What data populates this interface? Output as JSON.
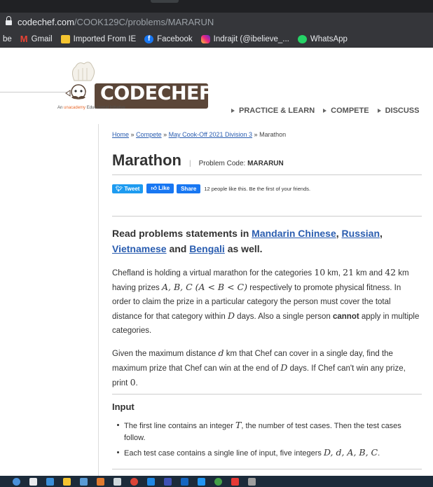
{
  "browser": {
    "url_host": "codechef.com",
    "url_path": "/COOK129C/problems/MARARUN",
    "bookmarks": [
      {
        "label": "Gmail",
        "icon": "gmail-icon"
      },
      {
        "label": "Imported From IE",
        "icon": "folder-icon"
      },
      {
        "label": "Facebook",
        "icon": "facebook-icon"
      },
      {
        "label": "Indrajit (@ibelieve_...",
        "icon": "instagram-icon"
      },
      {
        "label": "WhatsApp",
        "icon": "whatsapp-icon"
      }
    ],
    "bookmark_prefix": "be"
  },
  "header": {
    "logo_text": "CODECHEF",
    "tagline_pre": "An",
    "tagline_brand": "unacademy",
    "tagline_post": "Educational Initiative",
    "nav": [
      "PRACTICE & LEARN",
      "COMPETE",
      "DISCUSS"
    ]
  },
  "breadcrumb": {
    "home": "Home",
    "sep1": "»",
    "compete": "Compete",
    "sep2": "»",
    "contest": "May Cook-Off 2021 Division 3",
    "sep3": "»",
    "current": "Marathon"
  },
  "problem": {
    "title": "Marathon",
    "separator": "|",
    "code_label": "Problem Code:",
    "code": "MARARUN"
  },
  "social": {
    "tweet": "Tweet",
    "like": "Like",
    "share": "Share",
    "like_text": "12 people like this. Be the first of your friends."
  },
  "read_statements": {
    "pre": "Read problems statements in",
    "lang1": "Mandarin Chinese",
    "comma": ",",
    "lang2": "Russian",
    "comma2": ",",
    "lang3": "Vietnamese",
    "and": "and",
    "lang4": "Bengali",
    "post": "as well."
  },
  "statement": {
    "p1_a": "Chefland is holding a virtual marathon for the categories",
    "p1_v1": "10",
    "p1_b": "km,",
    "p1_v2": "21",
    "p1_c": "km and",
    "p1_v3": "42",
    "p1_d": "km having prizes",
    "p1_prizes": "A, B, C (A < B < C)",
    "p1_e": "respectively to promote physical fitness. In order to claim the prize in a particular category the person must cover the total distance for that category within",
    "p1_D": "D",
    "p1_f": "days. Also a single person",
    "p1_bold": "cannot",
    "p1_g": "apply in multiple categories.",
    "p2_a": "Given the maximum distance",
    "p2_d": "d",
    "p2_b": "km that Chef can cover in a single day, find the maximum prize that Chef can win at the end of",
    "p2_D": "D",
    "p2_c": "days. If Chef can't win any prize, print",
    "p2_zero": "0",
    "p2_dot": "."
  },
  "input_section": {
    "heading": "Input",
    "li1_a": "The first line contains an integer",
    "li1_T": "T",
    "li1_b": ", the number of test cases. Then the test cases follow.",
    "li2_a": "Each test case contains a single line of input, five integers",
    "li2_vars": "D, d, A, B, C",
    "li2_b": "."
  },
  "colors": {
    "link": "#2a5db0",
    "logo_brown": "#5b4638",
    "browser_bg": "#35363a",
    "taskbar": "#1c2b3a"
  }
}
